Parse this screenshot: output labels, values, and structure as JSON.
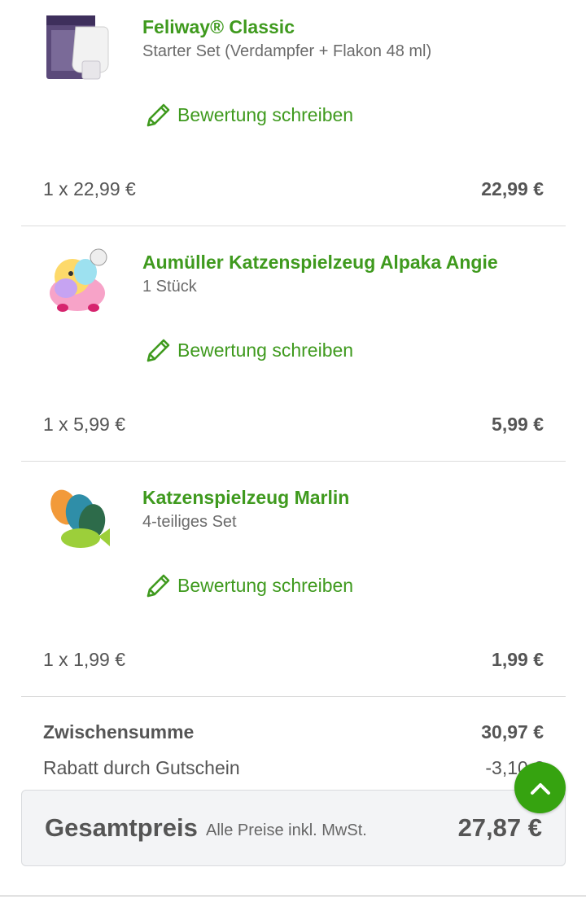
{
  "items": [
    {
      "name": "Feliway® Classic",
      "variant": "Starter Set (Verdampfer + Flakon 48 ml)",
      "review_label": "Bewertung schreiben",
      "quantity_price": "1 x 22,99 €",
      "total": "22,99 €"
    },
    {
      "name": "Aumüller Katzenspielzeug Alpaka Angie",
      "variant": "1 Stück",
      "review_label": "Bewertung schreiben",
      "quantity_price": "1 x 5,99 €",
      "total": "5,99 €"
    },
    {
      "name": "Katzenspielzeug Marlin",
      "variant": "4-teiliges Set",
      "review_label": "Bewertung schreiben",
      "quantity_price": "1 x 1,99 €",
      "total": "1,99 €"
    }
  ],
  "summary": {
    "subtotal_label": "Zwischensumme",
    "subtotal_value": "30,97 €",
    "discount_label": "Rabatt durch Gutschein",
    "discount_value": "-3,10 €"
  },
  "total": {
    "label": "Gesamtpreis",
    "note": "Alle Preise inkl. MwSt.",
    "value": "27,87 €"
  },
  "colors": {
    "accent": "#3f9a1e",
    "scroll_button": "#36a310"
  },
  "icons": {
    "review": "pencil-icon",
    "scroll_top": "chevron-up-icon"
  }
}
